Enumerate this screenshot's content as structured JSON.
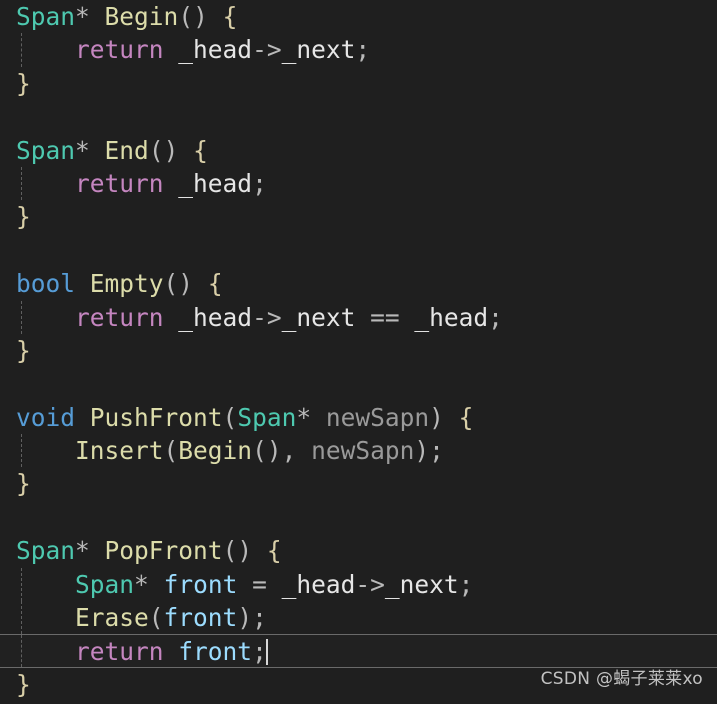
{
  "editor": {
    "theme_background": "#1f1f1f",
    "default_text_color": "#d4d4d4",
    "language": "cpp",
    "indent_guide_color": "#6b6b6b",
    "active_line_border_color": "#6a6a6a",
    "caret_color": "#d8d8d8",
    "cursor_line_index": 18,
    "cursor_column": 17
  },
  "colors": {
    "type": "#4ec9b0",
    "keyword": "#569cd6",
    "control": "#c586c0",
    "function": "#dcdcaa",
    "variable": "#9cdcfe",
    "parameter": "#9a9a9a",
    "member": "#e6e6e6",
    "punctuation": "#b9b9b9",
    "brace": "#d9cfa8"
  },
  "code": {
    "lines": [
      {
        "id": "l1",
        "active": false,
        "guide": false,
        "text": "Span* Begin() {"
      },
      {
        "id": "l2",
        "active": false,
        "guide": true,
        "text": "    return _head->_next;"
      },
      {
        "id": "l3",
        "active": false,
        "guide": false,
        "text": "}"
      },
      {
        "id": "l4",
        "active": false,
        "guide": false,
        "text": ""
      },
      {
        "id": "l5",
        "active": false,
        "guide": false,
        "text": "Span* End() {"
      },
      {
        "id": "l6",
        "active": false,
        "guide": true,
        "text": "    return _head;"
      },
      {
        "id": "l7",
        "active": false,
        "guide": false,
        "text": "}"
      },
      {
        "id": "l8",
        "active": false,
        "guide": false,
        "text": ""
      },
      {
        "id": "l9",
        "active": false,
        "guide": false,
        "text": "bool Empty() {"
      },
      {
        "id": "l10",
        "active": false,
        "guide": true,
        "text": "    return _head->_next == _head;"
      },
      {
        "id": "l11",
        "active": false,
        "guide": false,
        "text": "}"
      },
      {
        "id": "l12",
        "active": false,
        "guide": false,
        "text": ""
      },
      {
        "id": "l13",
        "active": false,
        "guide": false,
        "text": "void PushFront(Span* newSapn) {"
      },
      {
        "id": "l14",
        "active": false,
        "guide": true,
        "text": "    Insert(Begin(), newSapn);"
      },
      {
        "id": "l15",
        "active": false,
        "guide": false,
        "text": "}"
      },
      {
        "id": "l16",
        "active": false,
        "guide": false,
        "text": ""
      },
      {
        "id": "l17",
        "active": false,
        "guide": false,
        "text": "Span* PopFront() {"
      },
      {
        "id": "l18",
        "active": false,
        "guide": true,
        "text": "    Span* front = _head->_next;"
      },
      {
        "id": "l19",
        "active": false,
        "guide": true,
        "text": "    Erase(front);"
      },
      {
        "id": "l20",
        "active": true,
        "guide": true,
        "text": "    return front;"
      },
      {
        "id": "l21",
        "active": false,
        "guide": false,
        "text": "}"
      }
    ],
    "tokens": {
      "l1": [
        [
          "Span",
          "type"
        ],
        [
          "*",
          "punct"
        ],
        [
          " ",
          "plain"
        ],
        [
          "Begin",
          "func"
        ],
        [
          "()",
          "punct"
        ],
        [
          " ",
          "plain"
        ],
        [
          "{",
          "brace1"
        ]
      ],
      "l2": [
        [
          "    ",
          "plain"
        ],
        [
          "return",
          "ctrl"
        ],
        [
          " ",
          "plain"
        ],
        [
          "_head",
          "member"
        ],
        [
          "->",
          "punct"
        ],
        [
          "_next",
          "member"
        ],
        [
          ";",
          "punct"
        ]
      ],
      "l3": [
        [
          "}",
          "brace1"
        ]
      ],
      "l4": [],
      "l5": [
        [
          "Span",
          "type"
        ],
        [
          "*",
          "punct"
        ],
        [
          " ",
          "plain"
        ],
        [
          "End",
          "func"
        ],
        [
          "()",
          "punct"
        ],
        [
          " ",
          "plain"
        ],
        [
          "{",
          "brace1"
        ]
      ],
      "l6": [
        [
          "    ",
          "plain"
        ],
        [
          "return",
          "ctrl"
        ],
        [
          " ",
          "plain"
        ],
        [
          "_head",
          "member"
        ],
        [
          ";",
          "punct"
        ]
      ],
      "l7": [
        [
          "}",
          "brace1"
        ]
      ],
      "l8": [],
      "l9": [
        [
          "bool",
          "keyword"
        ],
        [
          " ",
          "plain"
        ],
        [
          "Empty",
          "func"
        ],
        [
          "()",
          "punct"
        ],
        [
          " ",
          "plain"
        ],
        [
          "{",
          "brace1"
        ]
      ],
      "l10": [
        [
          "    ",
          "plain"
        ],
        [
          "return",
          "ctrl"
        ],
        [
          " ",
          "plain"
        ],
        [
          "_head",
          "member"
        ],
        [
          "->",
          "punct"
        ],
        [
          "_next",
          "member"
        ],
        [
          " ",
          "plain"
        ],
        [
          "==",
          "punct"
        ],
        [
          " ",
          "plain"
        ],
        [
          "_head",
          "member"
        ],
        [
          ";",
          "punct"
        ]
      ],
      "l11": [
        [
          "}",
          "brace1"
        ]
      ],
      "l12": [],
      "l13": [
        [
          "void",
          "keyword"
        ],
        [
          " ",
          "plain"
        ],
        [
          "PushFront",
          "func"
        ],
        [
          "(",
          "punct"
        ],
        [
          "Span",
          "type"
        ],
        [
          "*",
          "punct"
        ],
        [
          " ",
          "plain"
        ],
        [
          "newSapn",
          "param"
        ],
        [
          ")",
          "punct"
        ],
        [
          " ",
          "plain"
        ],
        [
          "{",
          "brace1"
        ]
      ],
      "l14": [
        [
          "    ",
          "plain"
        ],
        [
          "Insert",
          "func"
        ],
        [
          "(",
          "punct"
        ],
        [
          "Begin",
          "func"
        ],
        [
          "()",
          "punct"
        ],
        [
          ",",
          "punct"
        ],
        [
          " ",
          "plain"
        ],
        [
          "newSapn",
          "param"
        ],
        [
          ")",
          "punct"
        ],
        [
          ";",
          "punct"
        ]
      ],
      "l15": [
        [
          "}",
          "brace1"
        ]
      ],
      "l16": [],
      "l17": [
        [
          "Span",
          "type"
        ],
        [
          "*",
          "punct"
        ],
        [
          " ",
          "plain"
        ],
        [
          "PopFront",
          "func"
        ],
        [
          "()",
          "punct"
        ],
        [
          " ",
          "plain"
        ],
        [
          "{",
          "brace1"
        ]
      ],
      "l18": [
        [
          "    ",
          "plain"
        ],
        [
          "Span",
          "type"
        ],
        [
          "*",
          "punct"
        ],
        [
          " ",
          "plain"
        ],
        [
          "front",
          "var"
        ],
        [
          " ",
          "plain"
        ],
        [
          "=",
          "punct"
        ],
        [
          " ",
          "plain"
        ],
        [
          "_head",
          "member"
        ],
        [
          "->",
          "punct"
        ],
        [
          "_next",
          "member"
        ],
        [
          ";",
          "punct"
        ]
      ],
      "l19": [
        [
          "    ",
          "plain"
        ],
        [
          "Erase",
          "func"
        ],
        [
          "(",
          "punct"
        ],
        [
          "front",
          "var"
        ],
        [
          ")",
          "punct"
        ],
        [
          ";",
          "punct"
        ]
      ],
      "l20": [
        [
          "    ",
          "plain"
        ],
        [
          "return",
          "ctrl"
        ],
        [
          " ",
          "plain"
        ],
        [
          "front",
          "var"
        ],
        [
          ";",
          "punct"
        ]
      ],
      "l21": [
        [
          "}",
          "brace1"
        ]
      ]
    }
  },
  "watermark": {
    "text": "CSDN @蝎子莱莱xo"
  }
}
